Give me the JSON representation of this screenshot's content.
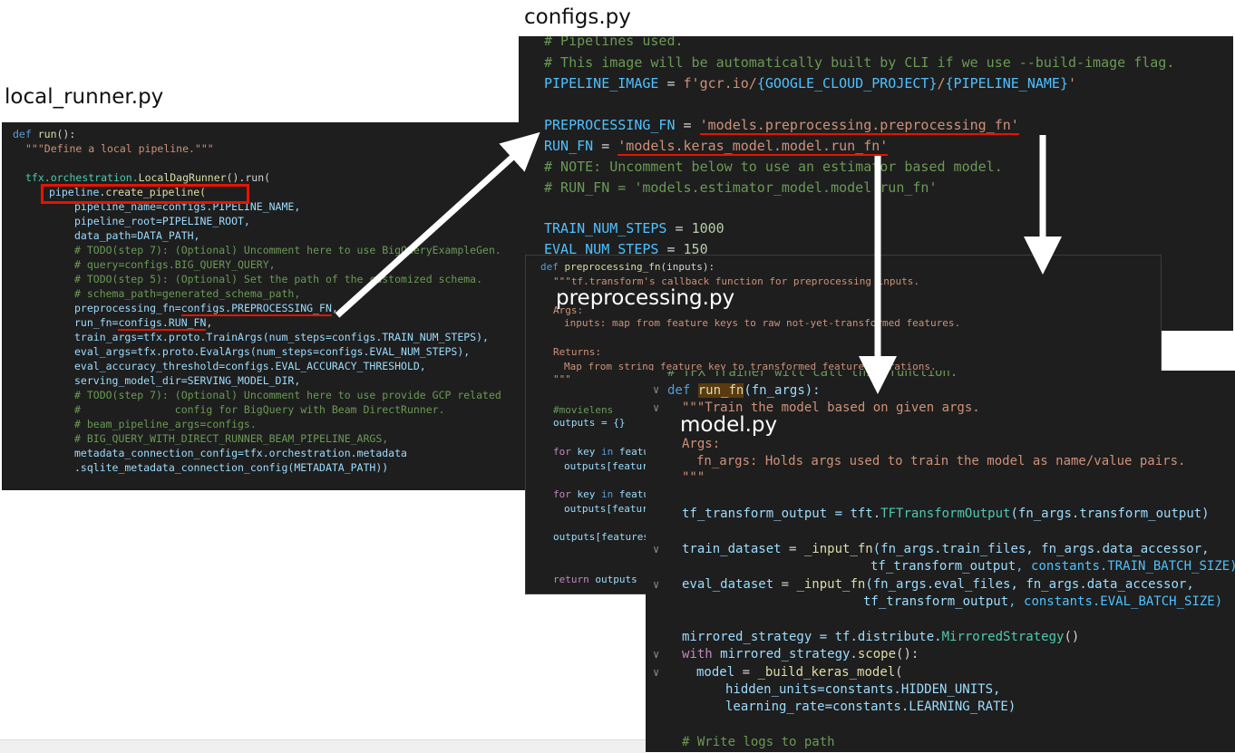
{
  "labels": {
    "local_runner": "local_runner.py",
    "configs": "configs.py",
    "preprocessing": "preprocessing.py",
    "model": "model.py"
  },
  "local_runner": {
    "l1_def": "def",
    "l1_name": "run",
    "l1_rest": "():",
    "l2_doc": "\"\"\"Define a local pipeline.\"\"\"",
    "l3_a": "tfx",
    "l3_b": ".orchestration.",
    "l3_c": "LocalDagRunner",
    "l3_d": "().run(",
    "l4_var": "pipeline",
    "l4_rest": ".create_pipeline(",
    "l5": "pipeline_name=configs.PIPELINE_NAME,",
    "l6": "pipeline_root=PIPELINE_ROOT,",
    "l7": "data_path=DATA_PATH,",
    "l8": "# TODO(step 7): (Optional) Uncomment here to use BigQueryExampleGen.",
    "l9": "# query=configs.BIG_QUERY_QUERY,",
    "l10": "# TODO(step 5): (Optional) Set the path of the customized schema.",
    "l11": "# schema_path=generated_schema_path,",
    "l12_a": "preprocessing_fn=",
    "l12_b": "configs.PREPROCESSING_FN",
    "l12_c": ",",
    "l13_a": "run_fn=",
    "l13_b": "configs.RUN_FN",
    "l13_c": ",",
    "l14": "train_args=tfx.proto.TrainArgs(num_steps=configs.TRAIN_NUM_STEPS),",
    "l15": "eval_args=tfx.proto.EvalArgs(num_steps=configs.EVAL_NUM_STEPS),",
    "l16": "eval_accuracy_threshold=configs.EVAL_ACCURACY_THRESHOLD,",
    "l17": "serving_model_dir=SERVING_MODEL_DIR,",
    "l18": "# TODO(step 7): (Optional) Uncomment here to use provide GCP related",
    "l19": "#               config for BigQuery with Beam DirectRunner.",
    "l20": "# beam_pipeline_args=configs.",
    "l21": "# BIG_QUERY_WITH_DIRECT_RUNNER_BEAM_PIPELINE_ARGS,",
    "l22": "metadata_connection_config=tfx.orchestration.metadata",
    "l23": ".sqlite_metadata_connection_config(METADATA_PATH))"
  },
  "configs": {
    "l0": "# Pipelines used.",
    "l1": "# This image will be automatically built by CLI if we use --build-image flag.",
    "l2_a": "PIPELINE_IMAGE",
    "l2_b": " = ",
    "l2_c": "f'gcr.io/",
    "l2_d": "{GOOGLE_CLOUD_PROJECT}",
    "l2_e": "/",
    "l2_f": "{PIPELINE_NAME}",
    "l2_g": "'",
    "l3_a": "PREPROCESSING_FN",
    "l3_b": " = ",
    "l3_c": "'models.preprocessing.preprocessing_fn'",
    "l4_a": "RUN_FN",
    "l4_b": " = ",
    "l4_c": "'models.keras_model.model.run_fn'",
    "l5": "# NOTE: Uncomment below to use an estimator based model.",
    "l6": "# RUN_FN = 'models.estimator_model.model.run_fn'",
    "l7_a": "TRAIN_NUM_STEPS",
    "l7_b": " = ",
    "l7_c": "1000",
    "l8_a": "EVAL_NUM_STEPS",
    "l8_b": " = ",
    "l8_c": "150"
  },
  "preprocessing": {
    "l1_def": "def",
    "l1_name": "preprocessing_fn",
    "l1_rest": "(inputs):",
    "l2": "\"\"\"tf.transform's callback function for preprocessing inputs.",
    "l3": "Args:",
    "l4": "inputs: map from feature keys to raw not-yet-transformed features.",
    "l5": "Returns:",
    "l6": "Map from string feature key to transformed feature operations.",
    "l7": "\"\"\"",
    "l8": "#movielens",
    "l9": "outputs = {}",
    "l10_kw": "for",
    "l10_rest": " key ",
    "l10_in": "in",
    "l10_tail": " featu",
    "l11": "outputs[featur",
    "l12_kw": "for",
    "l12_rest": " key ",
    "l12_in": "in",
    "l12_tail": " featu",
    "l13": "outputs[featur",
    "l14": "outputs[features",
    "l15_kw": "return",
    "l15_rest": " outputs"
  },
  "model": {
    "l0": "# TFX Trainer will call this function.",
    "l1_def": "def",
    "l1_name": "run_fn",
    "l1_rest": "(fn_args):",
    "l2": "\"\"\"Train the model based on given args.",
    "l3": "Args:",
    "l4": "fn_args: Holds args used to train the model as name/value pairs.",
    "l5": "\"\"\"",
    "l6_a": "tf_transform_output",
    "l6_b": " = tft.",
    "l6_c": "TFTransformOutput",
    "l6_d": "(fn_args.transform_output)",
    "l7_a": "train_dataset",
    "l7_b": " = ",
    "l7_c": "_input_fn",
    "l7_d": "(fn_args.train_files, fn_args.data_accessor,",
    "l8_a": "tf_transform_output",
    "l8_b": ", constants.TRAIN_BATCH_SIZE)",
    "l9_a": "eval_dataset",
    "l9_b": " = ",
    "l9_c": "_input_fn",
    "l9_d": "(fn_args.eval_files, fn_args.data_accessor,",
    "l10_a": "tf_transform_output",
    "l10_b": ", constants.EVAL_BATCH_SIZE)",
    "l11_a": "mirrored_strategy",
    "l11_b": " = tf.distribute.",
    "l11_c": "MirroredStrategy",
    "l11_d": "()",
    "l12_kw": "with",
    "l12_rest": " mirrored_strategy.",
    "l12_fn": "scope",
    "l12_end": "():",
    "l13_a": "model",
    "l13_b": " = ",
    "l13_c": "_build_keras_model",
    "l13_d": "(",
    "l14": "hidden_units=constants.HIDDEN_UNITS,",
    "l15": "learning_rate=constants.LEARNING_RATE)",
    "l16": "# Write logs to path",
    "fold_glyph": "∨"
  },
  "colors": {
    "highlight": "#e51400",
    "panel_bg": "#1e1e1e",
    "arrow": "#ffffff"
  }
}
